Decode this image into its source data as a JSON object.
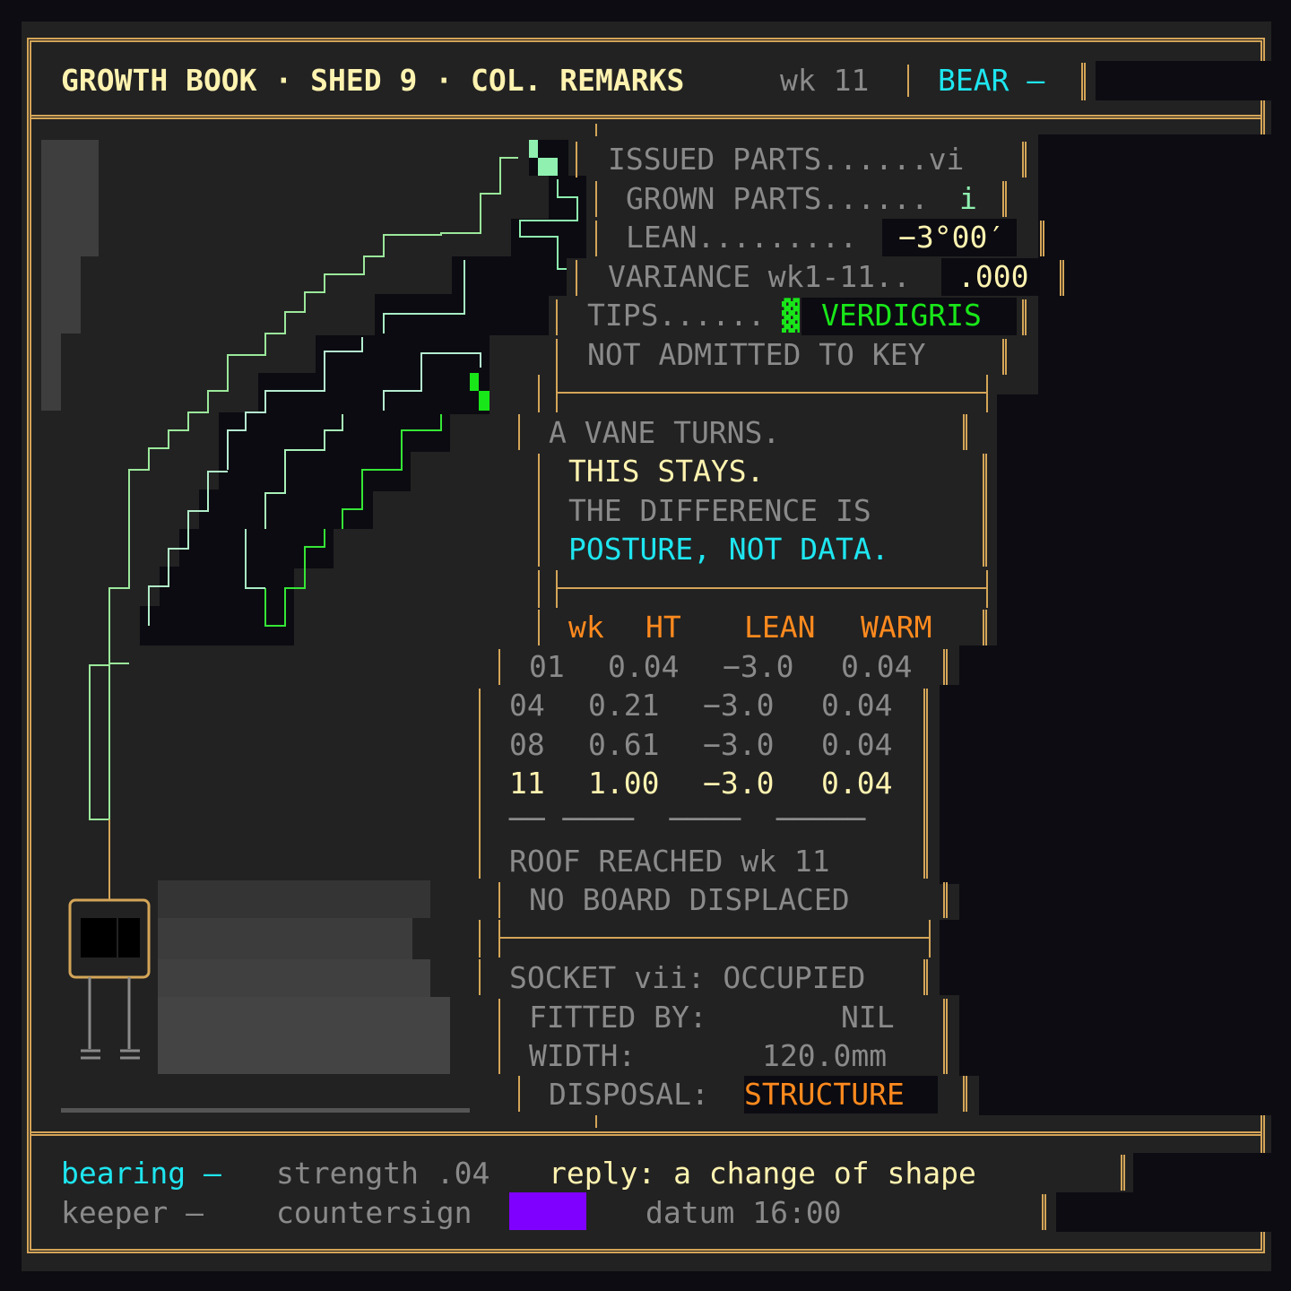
{
  "header": {
    "title": "GROWTH BOOK · SHED 9 · COL. REMARKS",
    "week": "wk 11",
    "bear": "BEAR —"
  },
  "parts": {
    "issued": "ISSUED PARTS......vi",
    "grown_label": "GROWN PARTS......",
    "grown_value": "i",
    "lean_label": "LEAN.........",
    "lean_value": "−3°00′",
    "variance_label": "VARIANCE wk1-11..",
    "variance_value": ".000",
    "tips_label": "TIPS......",
    "tips_glyph": "▓",
    "tips_value": "VERDIGRIS",
    "not_admitted": "NOT ADMITTED TO KEY"
  },
  "remarks": {
    "line1": "A VANE TURNS.",
    "line2": "THIS STAYS.",
    "line3": "THE DIFFERENCE IS",
    "line4": "POSTURE, NOT DATA."
  },
  "table": {
    "headers": [
      "wk",
      "HT",
      "LEAN",
      "WARM"
    ],
    "rows": [
      [
        "01",
        "0.04",
        "−3.0",
        "0.04"
      ],
      [
        "04",
        "0.21",
        "−3.0",
        "0.04"
      ],
      [
        "08",
        "0.61",
        "−3.0",
        "0.04"
      ],
      [
        "11",
        "1.00",
        "−3.0",
        "0.04"
      ]
    ],
    "rule": "── ────  ────  ─────",
    "roof": "ROOF REACHED wk 11",
    "board": "NO BOARD DISPLACED"
  },
  "socket": {
    "status": "SOCKET vii: OCCUPIED",
    "fitted_label": "FITTED BY:",
    "fitted_value": "NIL",
    "width_label": "WIDTH:",
    "width_value": "120.0mm",
    "disposal_label": "DISPOSAL:",
    "disposal_value": "STRUCTURE"
  },
  "footer": {
    "bearing": "bearing —",
    "strength": "strength .04",
    "reply": "reply: a change of shape",
    "keeper": "keeper —",
    "countersign": "countersign",
    "datum": "datum 16:00"
  },
  "colors": {
    "border": "#d4a558",
    "cream": "#fff3b0",
    "cyan": "#1ee6f0",
    "orange": "#ff8a1e",
    "green": "#19e619",
    "mint": "#8ff0b0",
    "swatch": "#8000ff"
  }
}
